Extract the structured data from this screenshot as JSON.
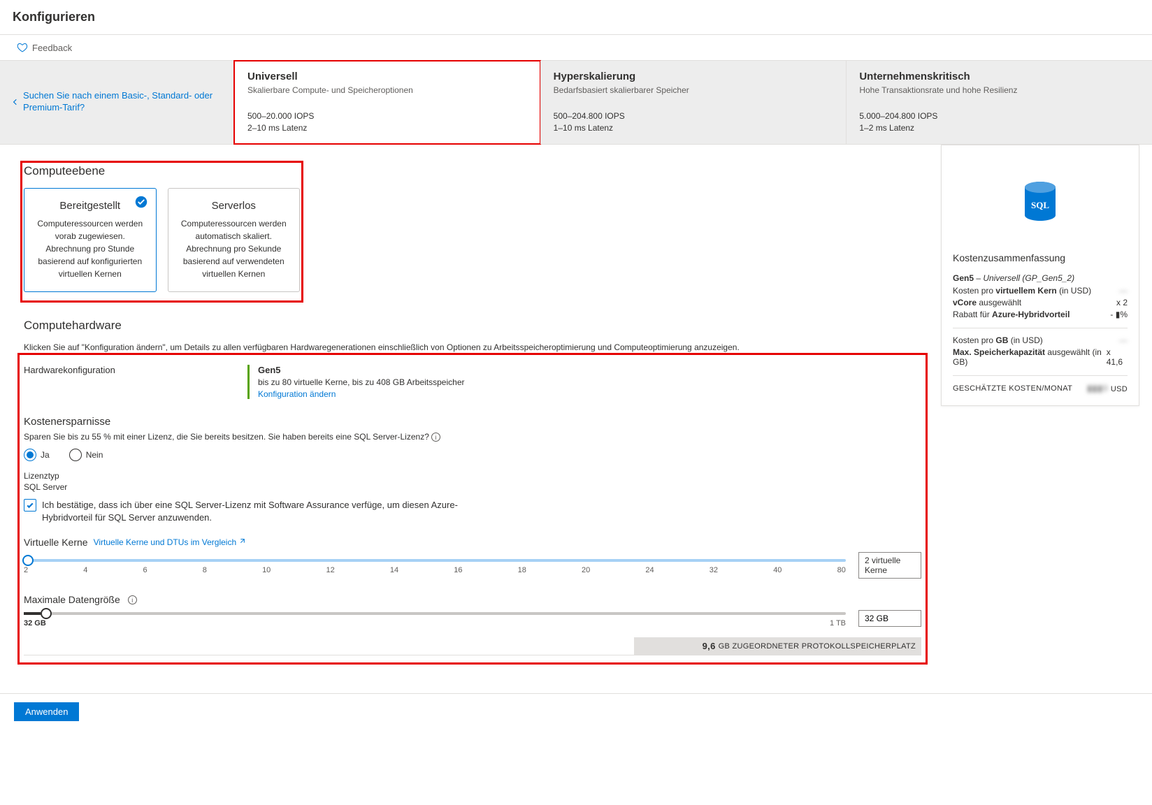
{
  "header": {
    "title": "Konfigurieren"
  },
  "feedback": {
    "label": "Feedback"
  },
  "backLink": "Suchen Sie nach einem Basic-, Standard- oder Premium-Tarif?",
  "tiers": [
    {
      "title": "Universell",
      "sub": "Skalierbare Compute- und Speicheroptionen",
      "spec1": "500–20.000 IOPS",
      "spec2": "2–10 ms Latenz",
      "selected": true
    },
    {
      "title": "Hyperskalierung",
      "sub": "Bedarfsbasiert skalierbarer Speicher",
      "spec1": "500–204.800 IOPS",
      "spec2": "1–10 ms Latenz",
      "selected": false
    },
    {
      "title": "Unternehmenskritisch",
      "sub": "Hohe Transaktionsrate und hohe Resilienz",
      "spec1": "5.000–204.800 IOPS",
      "spec2": "1–2 ms Latenz",
      "selected": false
    }
  ],
  "computeTier": {
    "heading": "Computeebene",
    "cards": [
      {
        "title": "Bereitgestellt",
        "line1": "Computeressourcen werden vorab zugewiesen.",
        "line2": "Abrechnung pro Stunde basierend auf konfigurierten virtuellen Kernen",
        "selected": true
      },
      {
        "title": "Serverlos",
        "line1": "Computeressourcen werden automatisch skaliert.",
        "line2": "Abrechnung pro Sekunde basierend auf verwendeten virtuellen Kernen",
        "selected": false
      }
    ]
  },
  "computeHw": {
    "heading": "Computehardware",
    "desc": "Klicken Sie auf \"Konfiguration ändern\", um Details zu allen verfügbaren Hardwaregenerationen einschließlich von Optionen zu Arbeitsspeicheroptimierung und Computeoptimierung anzuzeigen.",
    "label": "Hardwarekonfiguration",
    "name": "Gen5",
    "spec": "bis zu 80 virtuelle Kerne, bis zu 408 GB Arbeitsspeicher",
    "link": "Konfiguration ändern"
  },
  "savings": {
    "heading": "Kostenersparnisse",
    "desc": "Sparen Sie bis zu 55 % mit einer Lizenz, die Sie bereits besitzen. Sie haben bereits eine SQL Server-Lizenz?",
    "yes": "Ja",
    "no": "Nein",
    "licTypeLabel": "Lizenztyp",
    "licTypeValue": "SQL Server",
    "confirm": "Ich bestätige, dass ich über eine SQL Server-Lizenz mit Software Assurance verfüge, um diesen Azure-Hybridvorteil für SQL Server anzuwenden."
  },
  "vcores": {
    "heading": "Virtuelle Kerne",
    "link": "Virtuelle Kerne und DTUs im Vergleich",
    "ticks": [
      "2",
      "4",
      "6",
      "8",
      "10",
      "12",
      "14",
      "16",
      "18",
      "20",
      "24",
      "32",
      "40",
      "80"
    ],
    "valueLabel": "2 virtuelle Kerne"
  },
  "datasize": {
    "heading": "Maximale Datengröße",
    "minLabel": "32 GB",
    "maxLabel": "1 TB",
    "valueLabel": "32 GB",
    "allocNum": "9,6",
    "allocText": "GB ZUGEORDNETER PROTOKOLLSPEICHERPLATZ"
  },
  "apply": "Anwenden",
  "cost": {
    "heading": "Kostenzusammenfassung",
    "sku": "Gen5",
    "skuDetail": "Universell (GP_Gen5_2)",
    "perCoreLabel": "Kosten pro",
    "perCoreBold": "virtuellem Kern",
    "inUsd": "(in USD)",
    "perCoreVal": "—",
    "vcoreSelLabel": "vCore",
    "vcoreSelLabel2": "ausgewählt",
    "vcoreSelVal": "x 2",
    "hybridLabel": "Rabatt für",
    "hybridBold": "Azure-Hybridvorteil",
    "hybridVal": "- ▮%",
    "perGbLabel": "Kosten pro",
    "perGbBold": "GB",
    "perGbVal": "—",
    "maxStorLabel": "Max. Speicherkapazität",
    "maxStorLabel2": "ausgewählt (in GB)",
    "maxStorVal": "x 41,6",
    "totalLabel": "GESCHÄTZTE KOSTEN/MONAT",
    "totalVal": "▮▮▮9",
    "totalUnit": "USD"
  }
}
